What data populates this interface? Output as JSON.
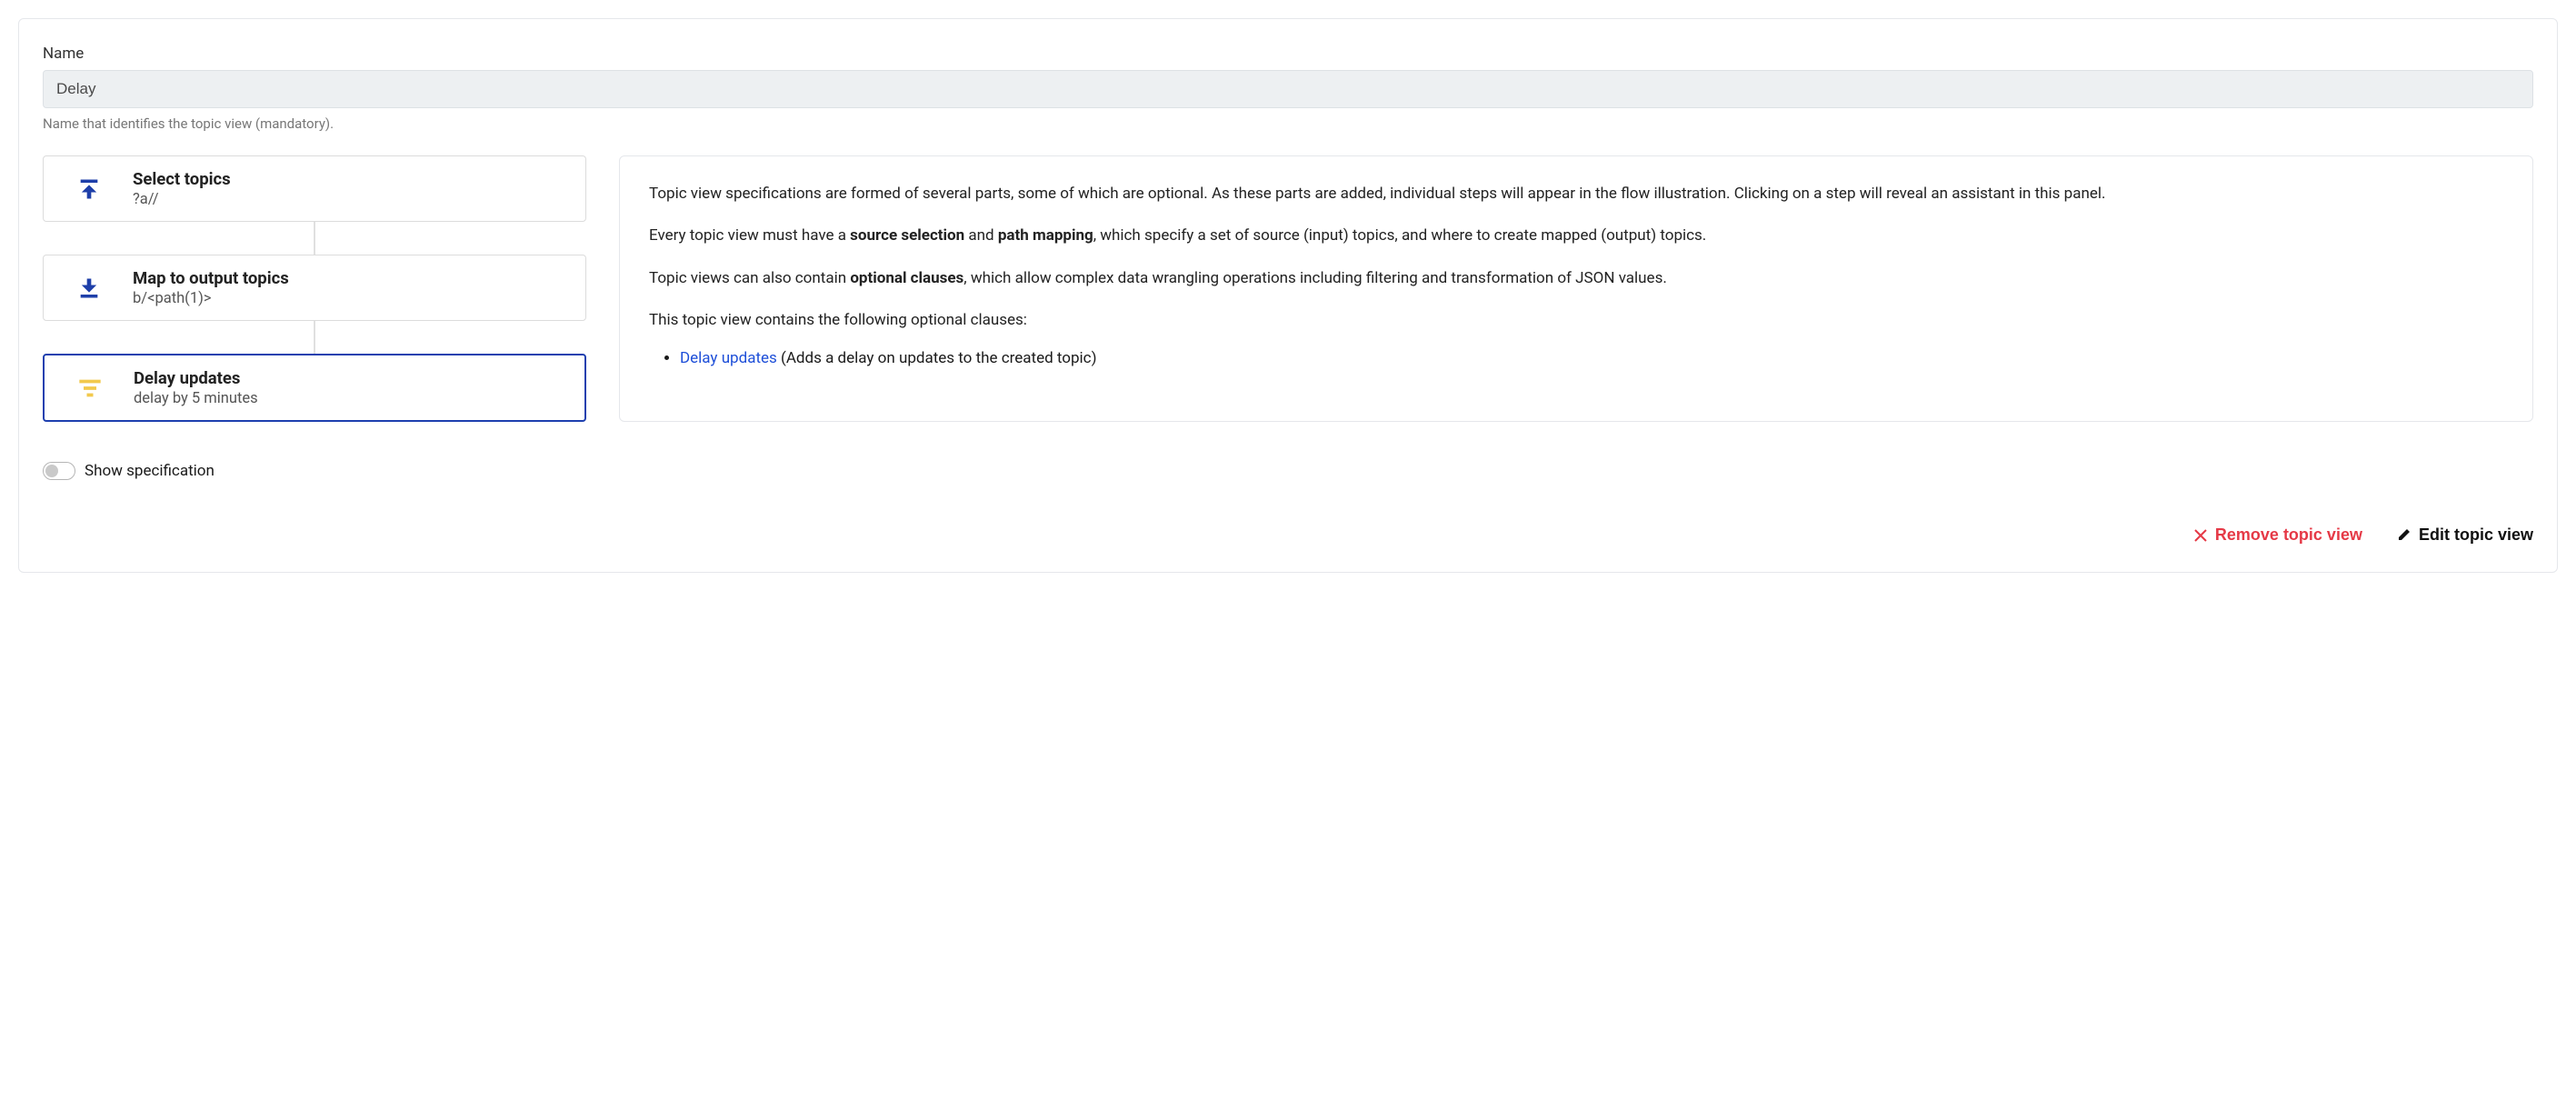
{
  "name": {
    "label": "Name",
    "value": "Delay",
    "hint": "Name that identifies the topic view (mandatory)."
  },
  "flow": {
    "steps": [
      {
        "title": "Select topics",
        "sub": "?a//"
      },
      {
        "title": "Map to output topics",
        "sub": "b/<path(1)>"
      },
      {
        "title": "Delay updates",
        "sub": "delay by 5 minutes"
      }
    ]
  },
  "info": {
    "p1": "Topic view specifications are formed of several parts, some of which are optional. As these parts are added, individual steps will appear in the flow illustration. Clicking on a step will reveal an assistant in this panel.",
    "p2_pre": "Every topic view must have a ",
    "p2_b1": "source selection",
    "p2_mid": " and ",
    "p2_b2": "path mapping",
    "p2_post": ", which specify a set of source (input) topics, and where to create mapped (output) topics.",
    "p3_pre": "Topic views can also contain ",
    "p3_b": "optional clauses",
    "p3_post": ", which allow complex data wrangling operations including filtering and transformation of JSON values.",
    "p4": "This topic view contains the following optional clauses:",
    "li_link": "Delay updates",
    "li_rest": " (Adds a delay on updates to the created topic)"
  },
  "footer": {
    "toggle_label": "Show specification",
    "remove_label": "Remove topic view",
    "edit_label": "Edit topic view"
  }
}
